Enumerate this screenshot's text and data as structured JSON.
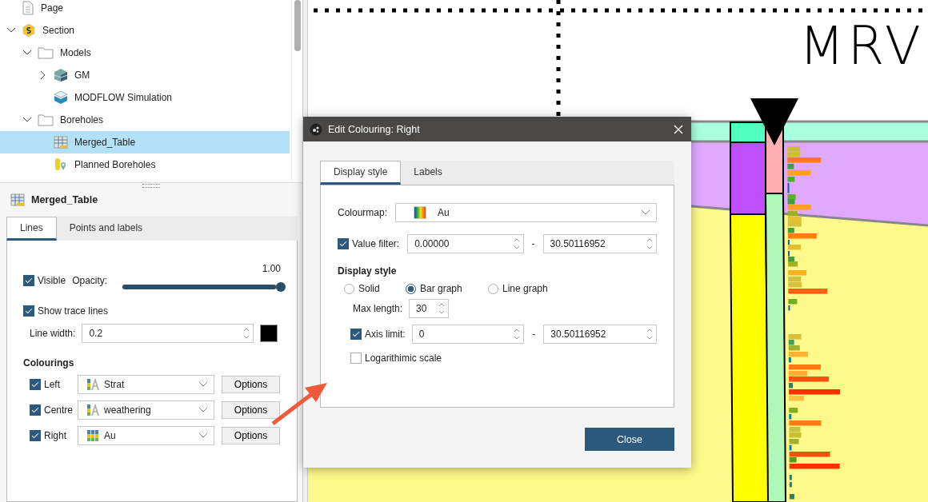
{
  "tree": [
    {
      "label": "Page",
      "kind": "page"
    },
    {
      "label": "Section",
      "kind": "section",
      "expanded": true,
      "selected": false,
      "children": [
        {
          "label": "Models",
          "kind": "folder",
          "expanded": true,
          "selected": false,
          "children": [
            {
              "label": "GM",
              "kind": "model",
              "expanded": false,
              "selected": false
            },
            {
              "label": "MODFLOW Simulation",
              "kind": "modflow",
              "selected": false
            }
          ]
        },
        {
          "label": "Boreholes",
          "kind": "folder",
          "expanded": true,
          "selected": false,
          "children": [
            {
              "label": "Merged_Table",
              "kind": "table",
              "selected": true
            },
            {
              "label": "Planned Boreholes",
              "kind": "planned",
              "selected": false
            }
          ]
        }
      ]
    }
  ],
  "properties": {
    "title": "Merged_Table",
    "tabs": [
      {
        "label": "Lines",
        "selected": true
      },
      {
        "label": "Points and labels",
        "selected": false
      }
    ],
    "visible": {
      "label": "Visible",
      "checked": true
    },
    "opacity": {
      "label": "Opacity:",
      "reading": "1.00",
      "level": 1.0
    },
    "trace_lines": {
      "label": "Show trace lines",
      "checked": true
    },
    "line_width": {
      "label": "Line width:",
      "value": "0.2"
    },
    "colourings_heading": "Colourings",
    "colourings": [
      {
        "label": "Left",
        "checked": true,
        "kind": "category",
        "value": "Strat",
        "button": "Options"
      },
      {
        "label": "Centre",
        "checked": true,
        "kind": "category",
        "value": "weathering",
        "button": "Options"
      },
      {
        "label": "Right",
        "checked": true,
        "kind": "numeric",
        "value": "Au",
        "button": "Options"
      }
    ]
  },
  "canvas": {
    "label": "MRV"
  },
  "dialog": {
    "title": "Edit Colouring: Right",
    "tabs": [
      {
        "label": "Display style",
        "selected": true
      },
      {
        "label": "Labels",
        "selected": false
      }
    ],
    "colourmap": {
      "label": "Colourmap:",
      "value": "Au"
    },
    "value_filter": {
      "label": "Value filter:",
      "checked": true,
      "from": "0.00000",
      "separator": "-",
      "to": "30.50116952"
    },
    "display_heading": "Display style",
    "styles": [
      {
        "label": "Solid",
        "selected": false
      },
      {
        "label": "Bar graph",
        "selected": true
      },
      {
        "label": "Line graph",
        "selected": false
      }
    ],
    "max_length": {
      "label": "Max length:",
      "value": "30"
    },
    "axis_limit": {
      "label": "Axis limit:",
      "checked": true,
      "from": "0",
      "separator": "-",
      "to": "30.50116952"
    },
    "log_scale": {
      "label": "Logarithimic scale",
      "checked": false
    },
    "close_button": "Close"
  }
}
